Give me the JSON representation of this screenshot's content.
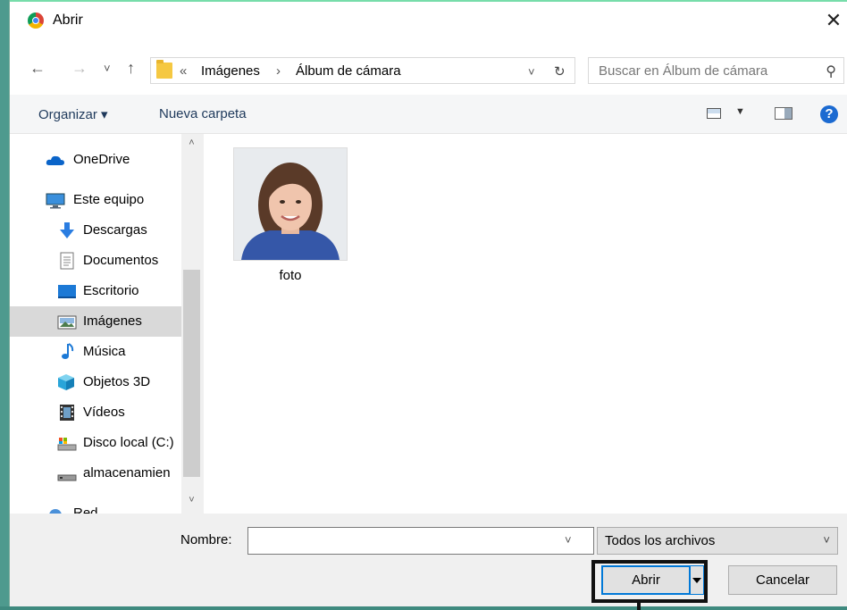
{
  "window": {
    "title": "Abrir",
    "close_symbol": "✕"
  },
  "nav": {
    "back": "←",
    "forward": "→",
    "recent": "˅",
    "up": "↑"
  },
  "address": {
    "overflow": "«",
    "crumbs": [
      "Imágenes",
      "Álbum de cámara"
    ],
    "separator": "›",
    "dropdown": "˅",
    "refresh": "↻"
  },
  "search": {
    "placeholder": "Buscar en Álbum de cámara",
    "icon": "⚲"
  },
  "toolbar": {
    "organize": "Organizar ▾",
    "new_folder": "Nueva carpeta",
    "help": "?"
  },
  "sidebar": {
    "items": [
      {
        "label": "OneDrive",
        "icon": "cloud-icon"
      },
      {
        "label": "Este equipo",
        "icon": "computer-icon"
      },
      {
        "label": "Descargas",
        "icon": "download-icon"
      },
      {
        "label": "Documentos",
        "icon": "document-icon"
      },
      {
        "label": "Escritorio",
        "icon": "desktop-icon"
      },
      {
        "label": "Imágenes",
        "icon": "pictures-icon",
        "selected": true
      },
      {
        "label": "Música",
        "icon": "music-icon"
      },
      {
        "label": "Objetos 3D",
        "icon": "cube-icon"
      },
      {
        "label": "Vídeos",
        "icon": "video-icon"
      },
      {
        "label": "Disco local (C:)",
        "icon": "drive-icon"
      },
      {
        "label": "almacenamien",
        "icon": "storage-icon"
      },
      {
        "label": "Red",
        "icon": "network-icon"
      }
    ],
    "scroll_up": "˄",
    "scroll_down": "˅"
  },
  "files": [
    {
      "name": "foto",
      "type": "image"
    }
  ],
  "bottom": {
    "name_label": "Nombre:",
    "name_value": "",
    "name_dropdown": "˅",
    "file_type": "Todos los archivos",
    "type_dropdown": "˅",
    "open_label": "Abrir",
    "cancel_label": "Cancelar"
  },
  "colors": {
    "accent": "#0078d7",
    "selected_bg": "#d9d9d9",
    "link_text": "#1e395b"
  }
}
